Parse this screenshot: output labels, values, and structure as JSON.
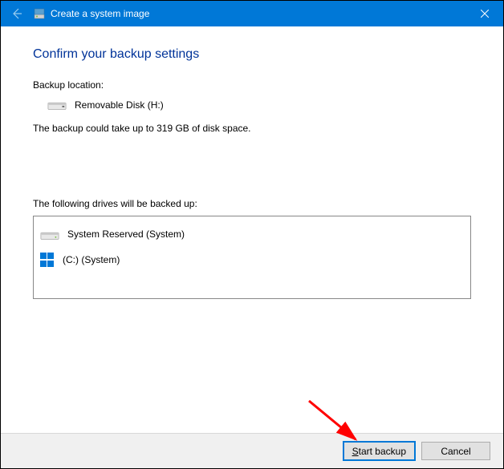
{
  "titlebar": {
    "title": "Create a system image"
  },
  "heading": "Confirm your backup settings",
  "backup_location": {
    "label": "Backup location:",
    "disk_name": "Removable Disk (H:)"
  },
  "space_warning": "The backup could take up to 319 GB of disk space.",
  "drives": {
    "label": "The following drives will be backed up:",
    "items": [
      {
        "name": "System Reserved (System)",
        "icon": "hdd"
      },
      {
        "name": "(C:) (System)",
        "icon": "windows"
      }
    ]
  },
  "buttons": {
    "start": "Start backup",
    "cancel": "Cancel"
  }
}
